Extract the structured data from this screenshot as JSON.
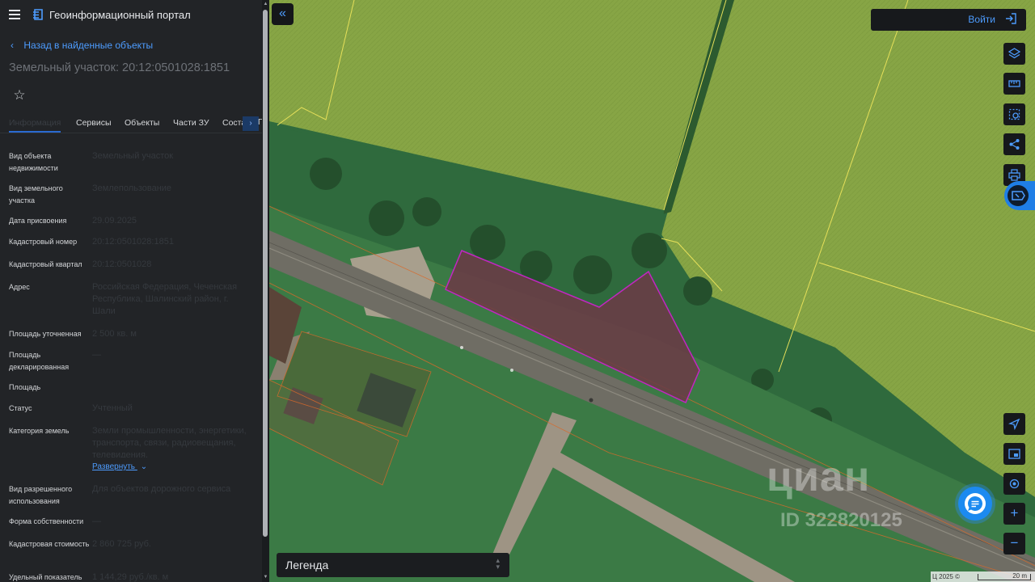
{
  "header": {
    "app_title": "Геоинформационный портал"
  },
  "nav": {
    "back_label": "Назад в найденные объекты"
  },
  "object": {
    "title": "Земельный участок: 20:12:0501028:1851"
  },
  "tabs": [
    {
      "label": "Информация"
    },
    {
      "label": "Сервисы"
    },
    {
      "label": "Объекты"
    },
    {
      "label": "Части ЗУ"
    },
    {
      "label": "Соста"
    },
    {
      "label": "Г"
    }
  ],
  "properties": [
    {
      "label": "Вид объекта недвижимости",
      "value": "Земельный участок"
    },
    {
      "label": "Вид земельного участка",
      "value": "Землепользование"
    },
    {
      "label": "Дата присвоения",
      "value": "29.09.2025"
    },
    {
      "label": "Кадастровый номер",
      "value": "20:12:0501028:1851"
    },
    {
      "label": "Кадастровый квартал",
      "value": "20:12:0501028"
    },
    {
      "label": "Адрес",
      "value": "Российская Федерация, Чеченская Республика, Шалинский район, г. Шали"
    },
    {
      "label": "Площадь уточненная",
      "value": "2 500 кв. м"
    },
    {
      "label": "Площадь декларированная",
      "value": "—"
    },
    {
      "label": "Площадь",
      "value": ""
    },
    {
      "label": "Статус",
      "value": "Учтенный"
    },
    {
      "label": "Категория земель",
      "value": "Земли промышленности, энергетики, транспорта, связи, радиовещания, телевидения,"
    },
    {
      "label": "Вид разрешенного использования",
      "value": "Для объектов дорожного сервиса"
    },
    {
      "label": "Форма собственности",
      "value": "—"
    },
    {
      "label": "Кадастровая стоимость",
      "value": "2 860 725 руб."
    },
    {
      "label": "Удельный показатель",
      "value": "1 144,29 руб./кв. м"
    }
  ],
  "expand_label": "Развернуть",
  "map": {
    "login_label": "Войти",
    "legend_label": "Легенда",
    "watermark_text": "циан",
    "watermark_id": "ID 322820125",
    "scale_label": "20 m",
    "attribution": "Ц 2025 ©",
    "colors": {
      "field": "#87a545",
      "grass": "#2f6a3d",
      "parcel_fill": "#6b3b47",
      "parcel_stroke": "#c226c2",
      "boundary": "#e6e05a",
      "road": "#6f6d64",
      "accent": "#4d9cff"
    }
  },
  "icons": {
    "menu": "hamburger-icon",
    "logo": "portal-logo-icon",
    "back": "chevron-left-icon",
    "favorite": "star-icon",
    "collapse": "double-chevron-left-icon",
    "login": "login-arrow-icon",
    "layers": "layers-icon",
    "measure": "ruler-icon",
    "select": "area-select-icon",
    "share": "share-icon",
    "print": "printer-icon",
    "assistant": "assistant-icon",
    "navigate": "navigation-arrow-icon",
    "minimap": "minimap-icon",
    "locate": "locate-icon",
    "chat": "chat-icon",
    "zoom_in": "plus-icon",
    "zoom_out": "minus-icon"
  }
}
